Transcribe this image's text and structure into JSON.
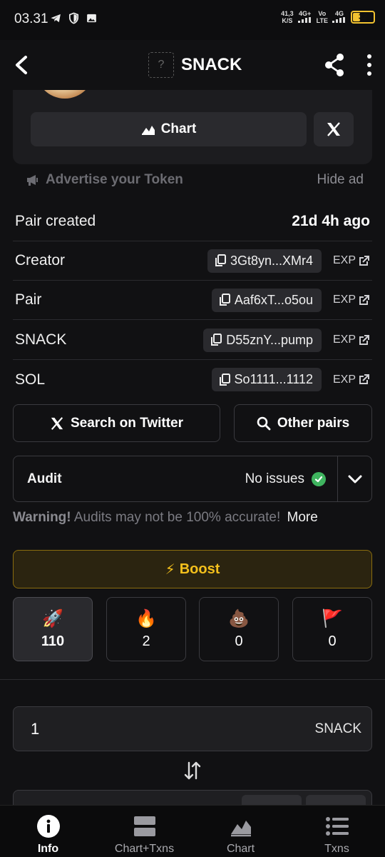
{
  "status_bar": {
    "time": "03.31",
    "net_speed": "41,3",
    "net_unit": "K/S",
    "net1": "4G+",
    "net2_top": "Vo",
    "net2_bottom": "LTE",
    "net3": "4G",
    "battery": "32",
    "battery_fraction": 0.32,
    "battery_color": "#f2c230"
  },
  "app_bar": {
    "title": "SNACK",
    "token_icon_placeholder": "?"
  },
  "token_card": {
    "chart_label": "Chart"
  },
  "ad": {
    "advertise_label": "Advertise your Token",
    "hide_label": "Hide ad"
  },
  "pair_created": {
    "label": "Pair created",
    "value": "21d 4h ago"
  },
  "addresses": [
    {
      "label": "Creator",
      "address": "3Gt8yn...XMr4",
      "exp": "EXP"
    },
    {
      "label": "Pair",
      "address": "Aaf6xT...o5ou",
      "exp": "EXP"
    },
    {
      "label": "SNACK",
      "address": "D55znY...pump",
      "exp": "EXP"
    },
    {
      "label": "SOL",
      "address": "So1111...1112",
      "exp": "EXP"
    }
  ],
  "actions": {
    "twitter_search": "Search on Twitter",
    "other_pairs": "Other pairs"
  },
  "audit": {
    "label": "Audit",
    "status": "No issues",
    "status_color": "#3fb45f"
  },
  "warning": {
    "bold": "Warning!",
    "text": "Audits may not be 100% accurate!",
    "more": "More"
  },
  "boost": {
    "icon": "⚡",
    "label": "Boost",
    "accent": "#f4c01c"
  },
  "reactions": [
    {
      "icon": "rocket-icon",
      "emoji": "🚀",
      "count": "110",
      "active": true
    },
    {
      "icon": "fire-icon",
      "emoji": "🔥",
      "count": "2",
      "active": false
    },
    {
      "icon": "poop-icon",
      "emoji": "💩",
      "count": "0",
      "active": false
    },
    {
      "icon": "red-flag-icon",
      "emoji": "🚩",
      "count": "0",
      "active": false
    }
  ],
  "swap": {
    "amount": "1",
    "token": "SNACK"
  },
  "bottom_nav": [
    {
      "label": "Info",
      "icon": "info-icon",
      "active": true
    },
    {
      "label": "Chart+Txns",
      "icon": "split-view-icon",
      "active": false
    },
    {
      "label": "Chart",
      "icon": "area-chart-icon",
      "active": false
    },
    {
      "label": "Txns",
      "icon": "list-icon",
      "active": false
    }
  ]
}
